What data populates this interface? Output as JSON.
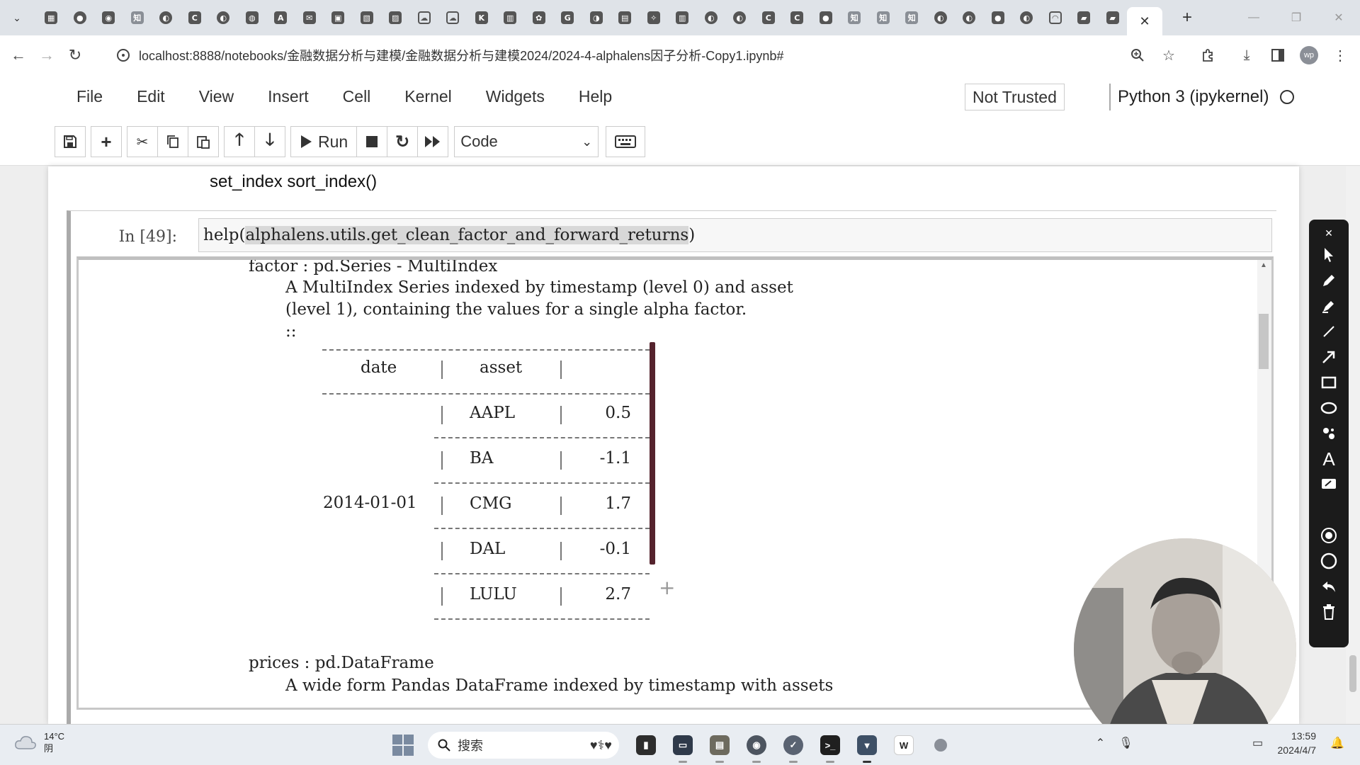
{
  "browser": {
    "tabs": [
      {
        "icon": "calendar-icon",
        "glyph": "▦"
      },
      {
        "icon": "chat-icon",
        "glyph": "●"
      },
      {
        "icon": "app-icon",
        "glyph": "◉"
      },
      {
        "icon": "zhihu-icon",
        "glyph": "知"
      },
      {
        "icon": "github-icon",
        "glyph": "◐"
      },
      {
        "icon": "c-app-icon",
        "glyph": "C"
      },
      {
        "icon": "github-icon",
        "glyph": "◐"
      },
      {
        "icon": "app-icon",
        "glyph": "◍"
      },
      {
        "icon": "letter-a-icon",
        "glyph": "A"
      },
      {
        "icon": "mail-icon",
        "glyph": "✉"
      },
      {
        "icon": "app-icon",
        "glyph": "▣"
      },
      {
        "icon": "app-icon",
        "glyph": "▧"
      },
      {
        "icon": "app-icon",
        "glyph": "▨"
      },
      {
        "icon": "cloud-icon",
        "glyph": "☁"
      },
      {
        "icon": "cloud-icon",
        "glyph": "☁"
      },
      {
        "icon": "app-icon",
        "glyph": "K"
      },
      {
        "icon": "book-icon",
        "glyph": "▥"
      },
      {
        "icon": "paw-icon",
        "glyph": "✿"
      },
      {
        "icon": "google-icon",
        "glyph": "G"
      },
      {
        "icon": "app-icon",
        "glyph": "◑"
      },
      {
        "icon": "app-icon",
        "glyph": "▤"
      },
      {
        "icon": "app-icon",
        "glyph": "✧"
      },
      {
        "icon": "book-icon",
        "glyph": "▥"
      },
      {
        "icon": "github-icon",
        "glyph": "◐"
      },
      {
        "icon": "github-icon",
        "glyph": "◐"
      },
      {
        "icon": "c-app-icon",
        "glyph": "C"
      },
      {
        "icon": "c-app-icon",
        "glyph": "C"
      },
      {
        "icon": "app-icon",
        "glyph": "●"
      },
      {
        "icon": "zhihu-icon",
        "glyph": "知"
      },
      {
        "icon": "zhihu-icon",
        "glyph": "知"
      },
      {
        "icon": "zhihu-icon",
        "glyph": "知"
      },
      {
        "icon": "github-icon",
        "glyph": "◐"
      },
      {
        "icon": "github-icon",
        "glyph": "◐"
      },
      {
        "icon": "app-icon",
        "glyph": "●"
      },
      {
        "icon": "github-icon",
        "glyph": "◐"
      },
      {
        "icon": "loading-icon",
        "glyph": "◠"
      },
      {
        "icon": "app-icon",
        "glyph": "▰"
      },
      {
        "icon": "app-icon",
        "glyph": "▰"
      }
    ],
    "active_tab_close": "✕",
    "new_tab": "+",
    "window_controls": [
      "—",
      "❐",
      "✕"
    ],
    "url": "localhost:8888/notebooks/金融数据分析与建模/金融数据分析与建模2024/2024-4-alphalens因子分析-Copy1.ipynb#"
  },
  "jupyter": {
    "menu": [
      "File",
      "Edit",
      "View",
      "Insert",
      "Cell",
      "Kernel",
      "Widgets",
      "Help"
    ],
    "trust_status": "Not Trusted",
    "kernel_name": "Python 3 (ipykernel)",
    "run_label": "Run",
    "cell_type": "Code"
  },
  "notebook": {
    "markdown_text": "set_index sort_index()",
    "cell_prompt": "In  [49]:",
    "input_prefix": "help(",
    "input_selected": "alphalens.utils.get_clean_factor_and_forward_returns",
    "input_suffix": ")",
    "doc": {
      "factor_line": "factor : pd.Series - MultiIndex",
      "factor_desc_1": "A MultiIndex Series indexed by timestamp (level 0) and asset",
      "factor_desc_2": "(level 1), containing the values for a single alpha factor.",
      "colons": "::",
      "table_headers": [
        "date",
        "asset"
      ],
      "table_date": "2014-01-01",
      "table_rows": [
        {
          "asset": "AAPL",
          "value": "0.5"
        },
        {
          "asset": "BA",
          "value": "-1.1"
        },
        {
          "asset": "CMG",
          "value": "1.7"
        },
        {
          "asset": "DAL",
          "value": "-0.1"
        },
        {
          "asset": "LULU",
          "value": "2.7"
        }
      ],
      "prices_line": "prices : pd.DataFrame",
      "prices_desc": "A wide form Pandas DataFrame indexed by timestamp with assets"
    }
  },
  "taskbar": {
    "temperature": "14°C",
    "weather": "阴",
    "search_label": "搜索",
    "time": "13:59",
    "date": "2024/4/7"
  }
}
